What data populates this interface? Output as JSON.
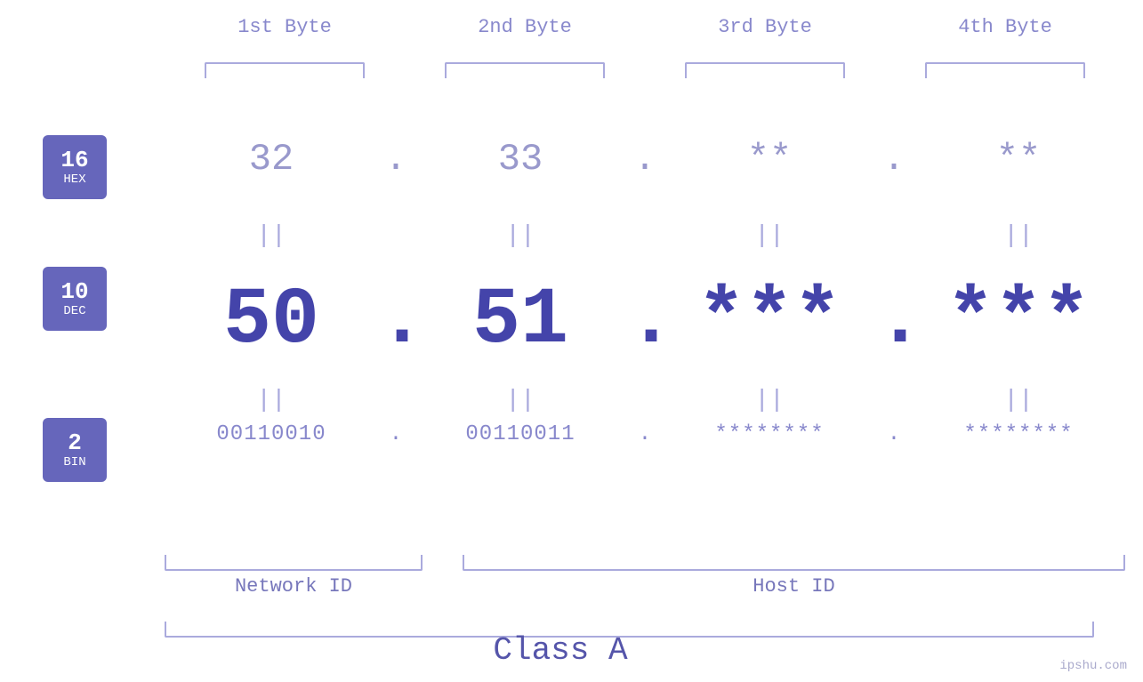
{
  "headers": {
    "byte1": "1st Byte",
    "byte2": "2nd Byte",
    "byte3": "3rd Byte",
    "byte4": "4th Byte"
  },
  "badges": {
    "hex": {
      "num": "16",
      "label": "HEX"
    },
    "dec": {
      "num": "10",
      "label": "DEC"
    },
    "bin": {
      "num": "2",
      "label": "BIN"
    }
  },
  "hex_row": {
    "b1": "32",
    "b2": "33",
    "b3": "**",
    "b4": "**",
    "dot": "."
  },
  "dec_row": {
    "b1": "50",
    "b2": "51",
    "b3": "***",
    "b4": "***",
    "dot": "."
  },
  "bin_row": {
    "b1": "00110010",
    "b2": "00110011",
    "b3": "********",
    "b4": "********",
    "dot": "."
  },
  "equals": {
    "symbol": "||"
  },
  "labels": {
    "network_id": "Network ID",
    "host_id": "Host ID",
    "class": "Class A"
  },
  "watermark": "ipshu.com"
}
